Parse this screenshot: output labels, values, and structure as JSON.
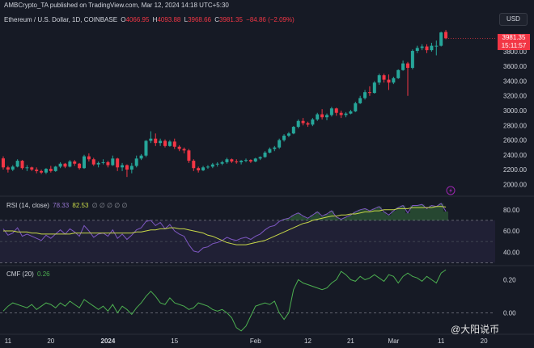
{
  "attribution": "AMBCrypto_TA published on TradingView.com, Mar 12, 2024 14:18 UTC+5:30",
  "symbol": "Ethereum / U.S. Dollar, 1D, COINBASE",
  "ohlc": {
    "o_label": "O",
    "o": "4066.95",
    "h_label": "H",
    "h": "4093.88",
    "l_label": "L",
    "l": "3968.66",
    "c_label": "C",
    "c": "3981.35",
    "change": "−84.86 (−2.09%)"
  },
  "currency_button": "USD",
  "last_price_tag": {
    "price": "3981.35",
    "countdown": "15:11:57"
  },
  "rsi": {
    "label": "RSI (14, close)",
    "value": "78.33",
    "ma_value": "82.53",
    "extra": "∅ ∅ ∅ ∅ ∅"
  },
  "cmf": {
    "label": "CMF (20)",
    "value": "0.26"
  },
  "watermark": "@大阳说币",
  "colors": {
    "up": "#26a69a",
    "down": "#f23645",
    "rsi": "#7e57c2",
    "rsi_ma": "#c8d848",
    "cmf": "#4caf50",
    "bg": "#161a25"
  },
  "chart_data": [
    {
      "type": "candlestick",
      "title": "Ethereum / U.S. Dollar, 1D, COINBASE",
      "ylim": [
        1850,
        4150
      ],
      "yticks": [
        2000,
        2200,
        2400,
        2600,
        2800,
        3000,
        3200,
        3400,
        3600,
        3800
      ],
      "x_range": [
        "2023-12-10",
        "2024-03-21"
      ],
      "x_tick_labels": [
        "11",
        "20",
        "2024",
        "15",
        "Feb",
        "12",
        "21",
        "Mar",
        "11",
        "20"
      ],
      "x_tick_dates": [
        "2023-12-11",
        "2023-12-20",
        "2024-01-01",
        "2024-01-15",
        "2024-02-01",
        "2024-02-12",
        "2024-02-21",
        "2024-03-01",
        "2024-03-11",
        "2024-03-20"
      ],
      "start_date": "2023-12-10",
      "candles": [
        [
          2352,
          2380,
          2200,
          2230
        ],
        [
          2230,
          2250,
          2160,
          2200
        ],
        [
          2200,
          2260,
          2180,
          2240
        ],
        [
          2240,
          2340,
          2230,
          2320
        ],
        [
          2320,
          2330,
          2200,
          2220
        ],
        [
          2220,
          2260,
          2180,
          2230
        ],
        [
          2230,
          2240,
          2180,
          2200
        ],
        [
          2200,
          2230,
          2150,
          2180
        ],
        [
          2180,
          2200,
          2140,
          2160
        ],
        [
          2160,
          2220,
          2140,
          2210
        ],
        [
          2210,
          2250,
          2160,
          2180
        ],
        [
          2180,
          2250,
          2170,
          2240
        ],
        [
          2240,
          2300,
          2220,
          2280
        ],
        [
          2280,
          2290,
          2220,
          2240
        ],
        [
          2240,
          2330,
          2230,
          2310
        ],
        [
          2310,
          2330,
          2250,
          2280
        ],
        [
          2280,
          2290,
          2200,
          2220
        ],
        [
          2220,
          2400,
          2210,
          2380
        ],
        [
          2380,
          2420,
          2310,
          2340
        ],
        [
          2340,
          2360,
          2250,
          2270
        ],
        [
          2270,
          2310,
          2230,
          2290
        ],
        [
          2290,
          2340,
          2270,
          2300
        ],
        [
          2300,
          2320,
          2230,
          2260
        ],
        [
          2260,
          2390,
          2250,
          2350
        ],
        [
          2350,
          2360,
          2180,
          2230
        ],
        [
          2230,
          2290,
          2180,
          2260
        ],
        [
          2260,
          2270,
          2100,
          2200
        ],
        [
          2200,
          2290,
          2150,
          2250
        ],
        [
          2250,
          2390,
          2230,
          2350
        ],
        [
          2350,
          2410,
          2330,
          2390
        ],
        [
          2390,
          2600,
          2370,
          2590
        ],
        [
          2590,
          2720,
          2560,
          2620
        ],
        [
          2620,
          2690,
          2520,
          2560
        ],
        [
          2560,
          2620,
          2520,
          2590
        ],
        [
          2590,
          2610,
          2500,
          2520
        ],
        [
          2520,
          2600,
          2510,
          2580
        ],
        [
          2580,
          2620,
          2480,
          2510
        ],
        [
          2510,
          2530,
          2450,
          2480
        ],
        [
          2480,
          2500,
          2420,
          2460
        ],
        [
          2460,
          2480,
          2290,
          2320
        ],
        [
          2320,
          2340,
          2180,
          2220
        ],
        [
          2220,
          2240,
          2160,
          2190
        ],
        [
          2190,
          2250,
          2180,
          2230
        ],
        [
          2230,
          2260,
          2210,
          2240
        ],
        [
          2240,
          2290,
          2220,
          2270
        ],
        [
          2270,
          2300,
          2240,
          2280
        ],
        [
          2280,
          2320,
          2260,
          2300
        ],
        [
          2300,
          2360,
          2280,
          2340
        ],
        [
          2340,
          2350,
          2290,
          2310
        ],
        [
          2310,
          2340,
          2280,
          2300
        ],
        [
          2300,
          2330,
          2270,
          2320
        ],
        [
          2320,
          2350,
          2300,
          2330
        ],
        [
          2330,
          2340,
          2290,
          2310
        ],
        [
          2310,
          2360,
          2300,
          2350
        ],
        [
          2350,
          2380,
          2330,
          2370
        ],
        [
          2370,
          2450,
          2360,
          2430
        ],
        [
          2430,
          2500,
          2420,
          2480
        ],
        [
          2480,
          2520,
          2450,
          2500
        ],
        [
          2500,
          2620,
          2480,
          2600
        ],
        [
          2600,
          2680,
          2580,
          2660
        ],
        [
          2660,
          2710,
          2640,
          2690
        ],
        [
          2690,
          2790,
          2680,
          2780
        ],
        [
          2780,
          2880,
          2760,
          2860
        ],
        [
          2860,
          2900,
          2800,
          2830
        ],
        [
          2830,
          2850,
          2780,
          2810
        ],
        [
          2810,
          2900,
          2790,
          2880
        ],
        [
          2880,
          2970,
          2860,
          2950
        ],
        [
          2950,
          3020,
          2880,
          2910
        ],
        [
          2910,
          2960,
          2870,
          2940
        ],
        [
          2940,
          3050,
          2920,
          3030
        ],
        [
          3030,
          3040,
          2930,
          2970
        ],
        [
          2970,
          3000,
          2900,
          2940
        ],
        [
          2940,
          2980,
          2910,
          2960
        ],
        [
          2960,
          3010,
          2950,
          2990
        ],
        [
          2990,
          3120,
          2980,
          3100
        ],
        [
          3100,
          3200,
          3090,
          3170
        ],
        [
          3170,
          3280,
          3150,
          3250
        ],
        [
          3250,
          3330,
          3200,
          3240
        ],
        [
          3240,
          3400,
          3230,
          3380
        ],
        [
          3380,
          3500,
          3350,
          3480
        ],
        [
          3480,
          3500,
          3380,
          3420
        ],
        [
          3420,
          3490,
          3280,
          3380
        ],
        [
          3380,
          3460,
          3360,
          3440
        ],
        [
          3440,
          3560,
          3430,
          3550
        ],
        [
          3550,
          3680,
          3540,
          3640
        ],
        [
          3640,
          3660,
          3200,
          3580
        ],
        [
          3580,
          3830,
          3560,
          3810
        ],
        [
          3810,
          3880,
          3780,
          3850
        ],
        [
          3850,
          3900,
          3820,
          3870
        ],
        [
          3870,
          3900,
          3780,
          3820
        ],
        [
          3820,
          3920,
          3800,
          3880
        ],
        [
          3880,
          3950,
          3750,
          3880
        ],
        [
          3880,
          4070,
          3870,
          4060
        ],
        [
          4066.95,
          4093.88,
          3968.66,
          3981.35
        ]
      ]
    },
    {
      "type": "line",
      "title": "RSI (14, close)",
      "ylim": [
        28,
        92
      ],
      "yticks": [
        40,
        60,
        80
      ],
      "bands": [
        30,
        50,
        70
      ],
      "series": [
        {
          "name": "RSI",
          "x_start": "2023-12-10",
          "values": [
            62,
            56,
            58,
            63,
            55,
            57,
            55,
            53,
            51,
            56,
            53,
            57,
            61,
            57,
            62,
            59,
            55,
            65,
            60,
            54,
            57,
            58,
            55,
            61,
            53,
            57,
            52,
            56,
            61,
            63,
            69,
            70,
            65,
            68,
            62,
            66,
            60,
            57,
            55,
            47,
            41,
            40,
            44,
            45,
            48,
            49,
            51,
            54,
            52,
            51,
            53,
            54,
            52,
            55,
            57,
            61,
            64,
            65,
            69,
            71,
            72,
            75,
            77,
            74,
            72,
            75,
            78,
            74,
            76,
            79,
            73,
            71,
            73,
            75,
            78,
            80,
            81,
            79,
            81,
            83,
            78,
            75,
            79,
            82,
            84,
            77,
            84,
            84,
            85,
            81,
            84,
            83,
            86,
            78.33
          ]
        },
        {
          "name": "RSI-based MA",
          "x_start": "2023-12-10",
          "values": [
            60,
            60,
            60,
            59,
            59,
            59,
            58,
            58,
            57,
            57,
            57,
            57,
            57,
            57,
            57,
            58,
            58,
            58,
            58,
            58,
            58,
            58,
            58,
            58,
            58,
            58,
            58,
            58,
            59,
            59,
            60,
            61,
            61,
            62,
            62,
            63,
            63,
            62,
            62,
            61,
            60,
            59,
            58,
            56,
            55,
            53,
            51,
            49,
            48,
            47,
            47,
            47,
            48,
            49,
            50,
            51,
            53,
            55,
            57,
            59,
            61,
            63,
            65,
            67,
            68,
            70,
            71,
            72,
            73,
            74,
            74,
            75,
            75,
            76,
            76,
            77,
            78,
            78,
            79,
            79,
            80,
            80,
            80,
            81,
            81,
            81,
            82,
            82,
            82,
            82,
            82,
            83,
            83,
            82.53
          ]
        }
      ]
    },
    {
      "type": "line",
      "title": "CMF (20)",
      "ylim": [
        -0.13,
        0.28
      ],
      "yticks": [
        0.0,
        0.2
      ],
      "zero_line": 0.0,
      "series": [
        {
          "name": "CMF",
          "x_start": "2023-12-10",
          "values": [
            0.01,
            0.04,
            0.06,
            0.05,
            0.04,
            0.03,
            0.05,
            0.02,
            0.04,
            0.06,
            0.05,
            0.03,
            0.06,
            0.04,
            0.07,
            0.05,
            0.03,
            0.08,
            0.06,
            0.04,
            0.02,
            0.04,
            0.01,
            0.05,
            0.0,
            0.04,
            0.02,
            -0.01,
            0.03,
            0.06,
            0.1,
            0.13,
            0.1,
            0.06,
            0.05,
            0.09,
            0.06,
            0.05,
            0.04,
            0.02,
            0.03,
            0.06,
            0.05,
            0.04,
            0.02,
            0.01,
            0.02,
            0.0,
            -0.03,
            -0.09,
            -0.11,
            -0.08,
            -0.02,
            0.04,
            0.05,
            0.06,
            0.05,
            0.07,
            0.0,
            -0.04,
            0.0,
            0.14,
            0.2,
            0.18,
            0.17,
            0.16,
            0.15,
            0.14,
            0.15,
            0.18,
            0.2,
            0.25,
            0.23,
            0.2,
            0.19,
            0.22,
            0.2,
            0.21,
            0.23,
            0.21,
            0.19,
            0.23,
            0.22,
            0.18,
            0.22,
            0.24,
            0.22,
            0.21,
            0.19,
            0.22,
            0.2,
            0.18,
            0.24,
            0.26
          ]
        }
      ]
    }
  ]
}
